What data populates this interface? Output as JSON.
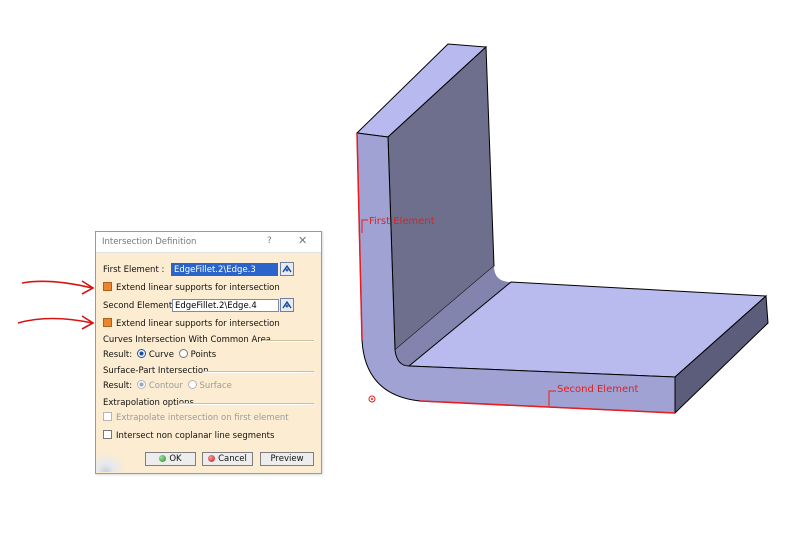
{
  "viewport": {
    "label_first_element": "First Element",
    "label_second_element": "Second Element",
    "colors": {
      "part_top": "#b8b9ef",
      "part_side": "#6e6f8d",
      "part_front": "#9c9dd0",
      "highlight": "#e81c1c"
    }
  },
  "dialog": {
    "title": "Intersection Definition",
    "help": "?",
    "close": "✕",
    "first_element_label": "First Element :",
    "first_element_value": "EdgeFillet.2\\Edge.3",
    "extend_first_label": "Extend linear supports for intersection",
    "second_element_label": "Second Element :",
    "second_element_value": "EdgeFillet.2\\Edge.4",
    "extend_second_label": "Extend linear supports for intersection",
    "curves_section": "Curves Intersection With Common Area",
    "result_label": "Result:",
    "curve_option": "Curve",
    "points_option": "Points",
    "surface_section": "Surface-Part Intersection",
    "surface_result_label": "Result:",
    "contour_option": "Contour",
    "surface_option": "Surface",
    "extrapolation_section": "Extrapolation options",
    "extrapolate_label": "Extrapolate intersection on first element",
    "coplanar_label": "Intersect non coplanar line segments",
    "ok_label": "OK",
    "cancel_label": "Cancel",
    "preview_label": "Preview",
    "accent_color": "#2a63c9",
    "background_color": "#fbecd2"
  }
}
